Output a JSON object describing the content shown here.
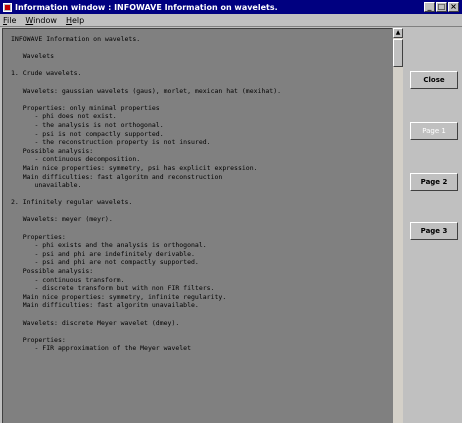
{
  "window": {
    "title": "Information window : INFOWAVE Information on wavelets."
  },
  "menu": [
    "File",
    "Window",
    "Help"
  ],
  "text_lines": [
    "INFOWAVE Information on wavelets.",
    "",
    "   Wavelets",
    "",
    "1. Crude wavelets.",
    "",
    "   Wavelets: gaussian wavelets (gaus), morlet, mexican hat (mexihat).",
    "",
    "   Properties: only minimal properties",
    "      - phi does not exist.",
    "      - the analysis is not orthogonal.",
    "      - psi is not compactly supported.",
    "      - the reconstruction property is not insured.",
    "   Possible analysis:",
    "      - continuous decomposition.",
    "   Main nice properties: symmetry, psi has explicit expression.",
    "   Main difficulties: fast algoritm and reconstruction",
    "      unavailable.",
    "",
    "2. Infinitely regular wavelets.",
    "",
    "   Wavelets: meyer (meyr).",
    "",
    "   Properties:",
    "      - phi exists and the analysis is orthogonal.",
    "      - psi and phi are indefinitely derivable.",
    "      - psi and phi are not compactly supported.",
    "   Possible analysis:",
    "      - continuous transform.",
    "      - discrete transform but with non FIR filters.",
    "   Main nice properties: symmetry, infinite regularity.",
    "   Main difficulties: fast algoritm unavailable.",
    "",
    "   Wavelets: discrete Meyer wavelet (dmey).",
    "",
    "   Properties:",
    "      - FIR approximation of the Meyer wavelet"
  ],
  "buttons": {
    "close": "Close",
    "page1": "Page 1",
    "page2": "Page 2",
    "page3": "Page 3"
  }
}
